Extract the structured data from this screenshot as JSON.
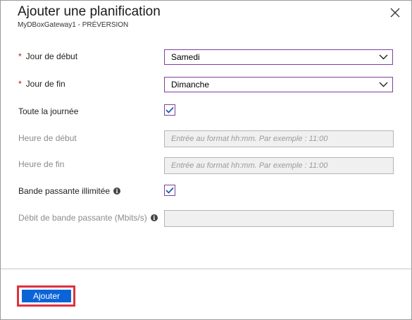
{
  "header": {
    "title": "Ajouter une planification",
    "subtitle": "MyDBoxGateway1 - PRÉVERSION",
    "close_icon": "close-icon"
  },
  "form": {
    "required_mark": "*",
    "jour_debut": {
      "label": "Jour de début",
      "value": "Samedi"
    },
    "jour_fin": {
      "label": "Jour de fin",
      "value": "Dimanche"
    },
    "toute_journee": {
      "label": "Toute la journée",
      "checked": true
    },
    "heure_debut": {
      "label": "Heure de début",
      "placeholder": "Entrée au format hh:mm. Par exemple : 11:00"
    },
    "heure_fin": {
      "label": "Heure de fin",
      "placeholder": "Entrée au format hh:mm. Par exemple : 11:00"
    },
    "bande_illimitee": {
      "label": "Bande passante illimitée",
      "checked": true
    },
    "debit": {
      "label": "Débit de bande passante (Mbits/s)",
      "value": ""
    }
  },
  "footer": {
    "submit_label": "Ajouter"
  },
  "colors": {
    "accent": "#7f3fa0",
    "primary_button": "#0a64d8",
    "highlight": "#e0313e",
    "required": "#c01010"
  }
}
